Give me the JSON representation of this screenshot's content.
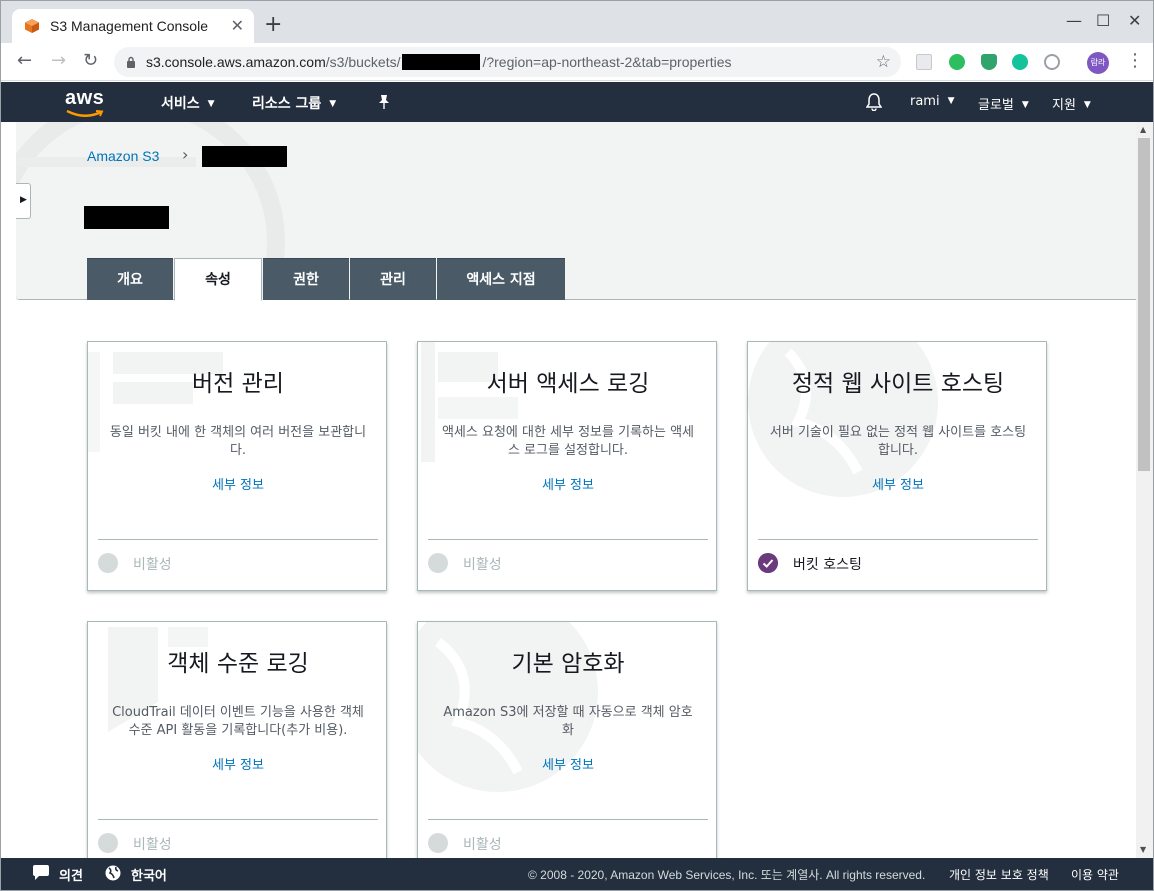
{
  "browser": {
    "tab_title": "S3 Management Console",
    "url_host": "s3.console.aws.amazon.com",
    "url_path": "/s3/buckets/",
    "url_query": "/?region=ap-northeast-2&tab=properties",
    "profile_initials": "람라"
  },
  "aws_nav": {
    "logo": "aws",
    "services": "서비스",
    "resource_groups": "리소스 그룹",
    "user": "rami",
    "region": "글로벌",
    "support": "지원"
  },
  "breadcrumb": {
    "root": "Amazon S3"
  },
  "tabs": [
    {
      "label": "개요"
    },
    {
      "label": "속성"
    },
    {
      "label": "권한"
    },
    {
      "label": "관리"
    },
    {
      "label": "액세스 지점"
    }
  ],
  "cards": [
    {
      "title": "버전 관리",
      "desc": "동일 버킷 내에 한 객체의 여러 버전을 보관합니다.",
      "link": "세부 정보",
      "status": "비활성",
      "enabled": false
    },
    {
      "title": "서버 액세스 로깅",
      "desc": "액세스 요청에 대한 세부 정보를 기록하는 액세스 로그를 설정합니다.",
      "link": "세부 정보",
      "status": "비활성",
      "enabled": false
    },
    {
      "title": "정적 웹 사이트 호스팅",
      "desc": "서버 기술이 필요 없는 정적 웹 사이트를 호스팅합니다.",
      "link": "세부 정보",
      "status": "버킷 호스팅",
      "enabled": true
    },
    {
      "title": "객체 수준 로깅",
      "desc": "CloudTrail 데이터 이벤트 기능을 사용한 객체 수준 API 활동을 기록합니다(추가 비용).",
      "link": "세부 정보",
      "status": "비활성",
      "enabled": false
    },
    {
      "title": "기본 암호화",
      "desc": "Amazon S3에 저장할 때 자동으로 객체 암호화",
      "link": "세부 정보",
      "status": "비활성",
      "enabled": false
    }
  ],
  "footer": {
    "feedback": "의견",
    "language": "한국어",
    "copyright": "© 2008 - 2020, Amazon Web Services, Inc. 또는 계열사. All rights reserved.",
    "privacy": "개인 정보 보호 정책",
    "terms": "이용 약관"
  },
  "colors": {
    "aws_navy": "#232f3e",
    "link_blue": "#0073bb",
    "tab_inactive": "#4a5a67",
    "enabled_purple": "#6b3a7d"
  }
}
